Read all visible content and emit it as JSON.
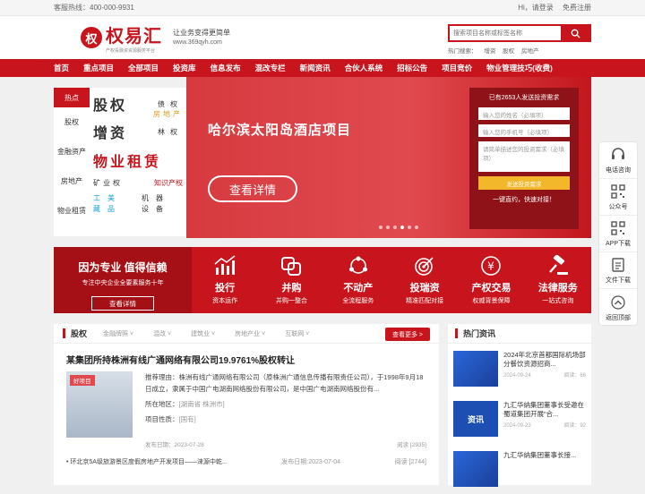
{
  "topbar": {
    "hotline": "客服热线：400-000-9931",
    "greeting": "Hi，请登录",
    "register": "免费注册"
  },
  "logo": {
    "mark": "权",
    "name": "权易汇",
    "sub": "产权投融资资源服务平台",
    "slogan": "让业务变得更简单",
    "url": "www.369qyh.com"
  },
  "search": {
    "placeholder": "搜索项目名称或标签名称",
    "hot_label": "热门搜索：",
    "hot": [
      "增资",
      "股权",
      "房地产"
    ]
  },
  "nav": [
    "首页",
    "重点项目",
    "全部项目",
    "投资库",
    "信息发布",
    "混改专栏",
    "新闻资讯",
    "合伙人系统",
    "招标公告",
    "项目竞价",
    "物业管理技巧(收费)"
  ],
  "categories": [
    "热点",
    "股权",
    "金融资产",
    "房地产",
    "物业租赁"
  ],
  "cat_grid": {
    "r1_big": "股权",
    "r1_sm": "债权",
    "r1b_sm": "房地产",
    "r2_big": "增资",
    "r2_sm": "林权",
    "r3_big": "物业租赁",
    "r4_a": "矿业权",
    "r4_b": "知识产权",
    "r5_a": "工美藏品",
    "r5_b": "机器设备"
  },
  "banner": {
    "title": "哈尔滨太阳岛酒店项目",
    "button": "查看详情"
  },
  "form": {
    "header": "已有2653人发送投资需求",
    "name_ph": "输入您的姓名（必填项）",
    "phone_ph": "输入您的手机号（必填项）",
    "need_ph": "请简单描述您的投资需求（必填项）",
    "submit": "发送投资需求",
    "footer": "一键直约，快速对接！"
  },
  "intro": {
    "title": "因为专业  值得信赖",
    "sub": "专注中央企业全要素服务十年",
    "button": "查看详情"
  },
  "services": [
    {
      "title": "投行",
      "sub": "资本运作",
      "icon": "chart-up-icon"
    },
    {
      "title": "并购",
      "sub": "并购一整合",
      "icon": "merge-icon"
    },
    {
      "title": "不动产",
      "sub": "全流程服务",
      "icon": "network-icon"
    },
    {
      "title": "投瑞资",
      "sub": "精准匹配对接",
      "icon": "target-icon"
    },
    {
      "title": "产权交易",
      "sub": "权威背景保障",
      "icon": "yuan-icon"
    },
    {
      "title": "法律服务",
      "sub": "一站式咨询",
      "icon": "gavel-icon"
    }
  ],
  "equity": {
    "heading": "股权",
    "tabs": [
      "金融牌照",
      "混改",
      "建筑业",
      "房地产业",
      "互联网"
    ],
    "more": "查看更多 >",
    "project_title": "某集团所持株洲有线广通网络有限公司19.9761%股权转让",
    "tag": "好项目",
    "desc": "推荐理由：株洲有线广通网络有限公司（原株洲广通信息传播有限责任公司），于1998年9月18日成立，隶属于中国广电湖南网络股份有限公司，是中国广电湖南网络股份有...",
    "location": "所在地区：",
    "location_val": "[湖南省 株洲市]",
    "nature": "项目性质：",
    "nature_val": "[国有]",
    "date": "发布日期：2023-07-28",
    "views": "阅读 [2935]",
    "list_item": "• 环北京5A级旅游景区度假房地产开发项目——涞源中乾...",
    "list_date": "发布日期:2023-07-04",
    "list_views": "阅读 [2744]"
  },
  "news": {
    "heading": "热门资讯",
    "items": [
      {
        "title": "2024年北京首都国际机场部分餐饮资源招商...",
        "date": "2024-09-24",
        "views": "阅读：66",
        "thumb": ""
      },
      {
        "title": "九汇华纳集团董事长受邀在蜀道集团开展“合...",
        "date": "2024-09-23",
        "views": "阅读：92",
        "thumb": "资讯"
      },
      {
        "title": "九汇华纳集团董事长接...",
        "date": "",
        "views": "",
        "thumb": ""
      }
    ]
  },
  "tools": [
    "电话咨询",
    "公众号",
    "APP下载",
    "文件下载",
    "返回顶部"
  ]
}
